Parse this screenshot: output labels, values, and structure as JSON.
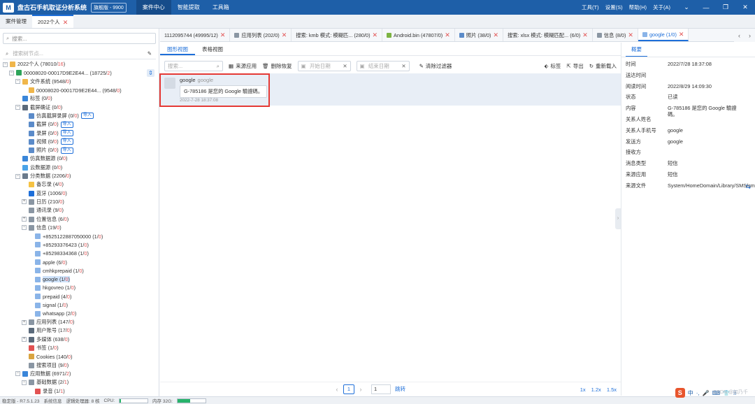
{
  "app": {
    "logo": "M",
    "title": "盘古石手机取证分析系统",
    "version": "旗舰版 - 9900",
    "nav": [
      "案件中心",
      "智能提取",
      "工具箱"
    ],
    "menus": [
      "工具(T)",
      "设置(S)",
      "帮助(H)",
      "关于(A)"
    ],
    "window_buttons": [
      "⌄",
      "—",
      "❐",
      "✕"
    ]
  },
  "case_tabs": [
    {
      "label": "案件管理",
      "closable": false
    },
    {
      "label": "2022个人",
      "closable": true,
      "active": true
    }
  ],
  "left_panel": {
    "search_placeholder": "搜索...",
    "filter_placeholder": "搜索树节点...",
    "tree": [
      {
        "indent": 0,
        "exp": "−",
        "icon": "folder-icon",
        "color": "#f0b64a",
        "label": "2022个人 (78010/",
        "red": "16",
        "tail": ")"
      },
      {
        "indent": 1,
        "exp": "−",
        "icon": "phone-icon",
        "color": "#2ea45a",
        "label": "00008020-00017D9E2E44... (18725/",
        "red": "2",
        "tail": ")"
      },
      {
        "indent": 2,
        "exp": "−",
        "icon": "folder-icon",
        "color": "#f0b64a",
        "label": "文件系统 (9548/",
        "red": "0",
        "tail": ")"
      },
      {
        "indent": 3,
        "exp": "",
        "icon": "folder-icon",
        "color": "#f0b64a",
        "label": "00008020-00017D9E2E44... (9548/",
        "red": "0",
        "tail": ")"
      },
      {
        "indent": 2,
        "exp": "",
        "icon": "tag-icon",
        "color": "#3a86d9",
        "label": "标签 (0/",
        "red": "0",
        "tail": ")"
      },
      {
        "indent": 2,
        "exp": "−",
        "icon": "screenshot-icon",
        "color": "#5b6a7b",
        "label": "截屏确证 (0/",
        "red": "0",
        "tail": ")"
      },
      {
        "indent": 3,
        "exp": "",
        "icon": "sim-screen-icon",
        "color": "#5b8bc9",
        "label": "仿真截屏录屏 (0/",
        "red": "0",
        "tail": ")",
        "import": "导入"
      },
      {
        "indent": 3,
        "exp": "",
        "icon": "screenshot-icon",
        "color": "#5b8bc9",
        "label": "截屏 (0/",
        "red": "0",
        "tail": ")",
        "import": "导入"
      },
      {
        "indent": 3,
        "exp": "",
        "icon": "record-icon",
        "color": "#5b8bc9",
        "label": "录屏 (0/",
        "red": "0",
        "tail": ")",
        "import": "导入"
      },
      {
        "indent": 3,
        "exp": "",
        "icon": "video-icon",
        "color": "#5b8bc9",
        "label": "视频 (0/",
        "red": "0",
        "tail": ")",
        "import": "导入"
      },
      {
        "indent": 3,
        "exp": "",
        "icon": "photo-icon",
        "color": "#5b8bc9",
        "label": "照片 (0/",
        "red": "0",
        "tail": ")",
        "import": "导入"
      },
      {
        "indent": 2,
        "exp": "",
        "icon": "sim-data-icon",
        "color": "#3a86d9",
        "label": "仿真数据源 (0/",
        "red": "0",
        "tail": ")"
      },
      {
        "indent": 2,
        "exp": "",
        "icon": "cloud-icon",
        "color": "#4aa3e8",
        "label": "云数据源 (0/",
        "red": "0",
        "tail": ")"
      },
      {
        "indent": 2,
        "exp": "−",
        "icon": "category-icon",
        "color": "#6b7b8c",
        "label": "分类数据 (2206/",
        "red": "0",
        "tail": ")"
      },
      {
        "indent": 3,
        "exp": "",
        "icon": "memo-icon",
        "color": "#f5c243",
        "label": "备忘录 (4/",
        "red": "0",
        "tail": ")"
      },
      {
        "indent": 3,
        "exp": "",
        "icon": "bluetooth-icon",
        "color": "#1e6fd9",
        "label": "蓝牙 (1006/",
        "red": "0",
        "tail": ")"
      },
      {
        "indent": 3,
        "exp": "+",
        "icon": "calendar-icon",
        "color": "#8a96a3",
        "label": "日历 (210/",
        "red": "0",
        "tail": ")"
      },
      {
        "indent": 3,
        "exp": "",
        "icon": "contacts-icon",
        "color": "#8a96a3",
        "label": "通讯录 (9/",
        "red": "0",
        "tail": ")"
      },
      {
        "indent": 3,
        "exp": "+",
        "icon": "location-icon",
        "color": "#8a96a3",
        "label": "位置信息 (6/",
        "red": "0",
        "tail": ")"
      },
      {
        "indent": 3,
        "exp": "−",
        "icon": "message-icon",
        "color": "#8a96a3",
        "label": "信息 (19/",
        "red": "0",
        "tail": ")"
      },
      {
        "indent": 4,
        "exp": "",
        "icon": "chat-icon",
        "color": "#8ab4e8",
        "label": "+8525122887050000 (1/",
        "red": "0",
        "tail": ")"
      },
      {
        "indent": 4,
        "exp": "",
        "icon": "chat-icon",
        "color": "#8ab4e8",
        "label": "+85293376423 (1/",
        "red": "0",
        "tail": ")"
      },
      {
        "indent": 4,
        "exp": "",
        "icon": "chat-icon",
        "color": "#8ab4e8",
        "label": "+85298334368 (1/",
        "red": "0",
        "tail": ")"
      },
      {
        "indent": 4,
        "exp": "",
        "icon": "chat-icon",
        "color": "#8ab4e8",
        "label": "apple (6/",
        "red": "0",
        "tail": ")"
      },
      {
        "indent": 4,
        "exp": "",
        "icon": "chat-icon",
        "color": "#8ab4e8",
        "label": "cmhkprepaid (1/",
        "red": "0",
        "tail": ")"
      },
      {
        "indent": 4,
        "exp": "",
        "icon": "chat-icon",
        "color": "#8ab4e8",
        "label": "google (1/",
        "red": "0",
        "tail": ")",
        "selected": true
      },
      {
        "indent": 4,
        "exp": "",
        "icon": "chat-icon",
        "color": "#8ab4e8",
        "label": "hkgovreo (1/",
        "red": "0",
        "tail": ")"
      },
      {
        "indent": 4,
        "exp": "",
        "icon": "chat-icon",
        "color": "#8ab4e8",
        "label": "prepaid (4/",
        "red": "0",
        "tail": ")"
      },
      {
        "indent": 4,
        "exp": "",
        "icon": "chat-icon",
        "color": "#8ab4e8",
        "label": "signal (1/",
        "red": "0",
        "tail": ")"
      },
      {
        "indent": 4,
        "exp": "",
        "icon": "chat-icon",
        "color": "#8ab4e8",
        "label": "whatsapp (2/",
        "red": "0",
        "tail": ")"
      },
      {
        "indent": 3,
        "exp": "+",
        "icon": "app-list-icon",
        "color": "#8a96a3",
        "label": "应用列表 (147/",
        "red": "0",
        "tail": ")"
      },
      {
        "indent": 3,
        "exp": "",
        "icon": "account-icon",
        "color": "#5b6a7b",
        "label": "用户账号 (17/",
        "red": "0",
        "tail": ")"
      },
      {
        "indent": 3,
        "exp": "+",
        "icon": "media-icon",
        "color": "#5b6a7b",
        "label": "多媒体 (638/",
        "red": "0",
        "tail": ")"
      },
      {
        "indent": 3,
        "exp": "",
        "icon": "bookmark-icon",
        "color": "#e25252",
        "label": "书签 (1/",
        "red": "0",
        "tail": ")"
      },
      {
        "indent": 3,
        "exp": "",
        "icon": "cookie-icon",
        "color": "#d9a441",
        "label": "Cookies (140/",
        "red": "0",
        "tail": ")"
      },
      {
        "indent": 3,
        "exp": "",
        "icon": "search-item-icon",
        "color": "#8a96a3",
        "label": "搜索项目 (9/",
        "red": "0",
        "tail": ")"
      },
      {
        "indent": 2,
        "exp": "−",
        "icon": "app-data-icon",
        "color": "#3a86d9",
        "label": "应用数据 (6971/",
        "red": "2",
        "tail": ")"
      },
      {
        "indent": 3,
        "exp": "−",
        "icon": "base-data-icon",
        "color": "#8a96a3",
        "label": "基础数据 (2/",
        "red": "1",
        "tail": ")"
      },
      {
        "indent": 4,
        "exp": "",
        "icon": "app-icon",
        "color": "#e25252",
        "label": "录音 (1/",
        "red": "1",
        "tail": ")"
      }
    ]
  },
  "data_tabs": [
    {
      "label": "1112095744 (49995/12)",
      "icon": "",
      "color": ""
    },
    {
      "label": "应用列表 (202/0)",
      "icon": "app-list-icon",
      "color": "#8a96a3"
    },
    {
      "label": "搜索: kmb 模式: 模糊匹... (280/0)",
      "icon": "",
      "color": ""
    },
    {
      "label": "Android.bin (47807/0)",
      "icon": "android-icon",
      "color": "#7cb342"
    },
    {
      "label": "照片 (38/0)",
      "icon": "photo-icon",
      "color": "#5b8bc9"
    },
    {
      "label": "搜索: xlsx 模式: 模糊匹配... (6/0)",
      "icon": "",
      "color": ""
    },
    {
      "label": "信息 (8/0)",
      "icon": "message-icon",
      "color": "#8a96a3"
    },
    {
      "label": "google (1/0)",
      "icon": "chat-icon",
      "color": "#8ab4e8",
      "active": true
    }
  ],
  "view_tabs": [
    "图形视图",
    "表格视图"
  ],
  "toolbar": {
    "search_placeholder": "搜索...",
    "source_app": "来源应用",
    "delete_restore": "删除恢复",
    "start_date": "开始日期",
    "end_date": "结束日期",
    "clear_filter": "清除过滤器",
    "tag": "标签",
    "export": "导出",
    "reload": "重新载入"
  },
  "message": {
    "sender": "google",
    "sender_sub": "google",
    "content": "G-785186 是您的 Google 驗證碼。",
    "time": "2022-7-28 18:37:08"
  },
  "pager": {
    "page": "1",
    "goto_value": "1",
    "goto_label": "跳转",
    "zoom": [
      "1x",
      "1.2x",
      "1.5x"
    ]
  },
  "detail": {
    "tab": "概要",
    "props": [
      {
        "k": "时间",
        "v": "2022/7/28 18:37:08"
      },
      {
        "k": "送达时间",
        "v": ""
      },
      {
        "k": "阅读时间",
        "v": "2022/8/29 14:09:30"
      },
      {
        "k": "状态",
        "v": "已读"
      },
      {
        "k": "内容",
        "v": "G-785186 是您的 Google 驗證碼。"
      },
      {
        "k": "关系人姓名",
        "v": ""
      },
      {
        "k": "关系人手机号",
        "v": "google"
      },
      {
        "k": "发送方",
        "v": "google"
      },
      {
        "k": "接收方",
        "v": ""
      },
      {
        "k": "消息类型",
        "v": "短信"
      },
      {
        "k": "来源应用",
        "v": "短信"
      },
      {
        "k": "来源文件",
        "v": "System/HomeDomain/Library/SMS/sms.db"
      }
    ]
  },
  "status": {
    "items": [
      "稳定版 - R7.5.1.23",
      "系统信息",
      "逻辑处理器: 8 核",
      "CPU:"
    ],
    "mem_label": "内存 32G:",
    "cpu_fraction": 0.05,
    "mem_fraction": 0.45,
    "watermark": "CSDN @如乃千",
    "ime_items": [
      "S",
      "中",
      "·,",
      "🎤",
      "⌨",
      "👕",
      "⠿"
    ]
  }
}
